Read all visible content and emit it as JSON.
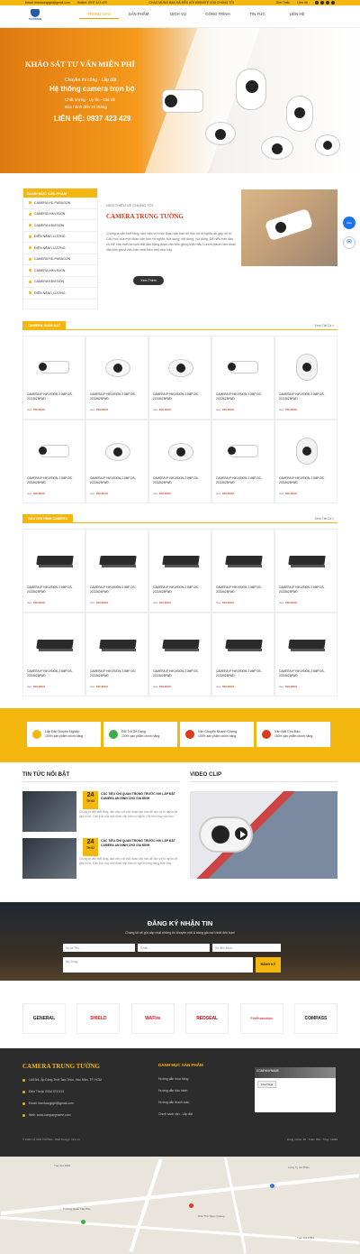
{
  "topbar": {
    "email": "Email: leantuongtgbl@gmail.com",
    "phone": "Hotline: 0937 423 429",
    "welcome": "CHÀO MỪNG BẠN ĐÃ ĐẾN VỚI WEBSITE CỦA CHÚNG TÔI",
    "intro": "Giới Thiệu",
    "contact": "Liên Hệ"
  },
  "logo": {
    "text": "YOURNAME"
  },
  "nav": [
    "TRANG CHỦ",
    "SẢN PHẨM",
    "DỊCH VỤ",
    "CÔNG TRÌNH",
    "TIN TỨC",
    "LIÊN HỆ"
  ],
  "banner": {
    "title": "KHẢO SÁT TƯ VẤN MIỄN PHÍ",
    "line1": "Chuyên thi công - Lắp đặt",
    "line2": "Hệ thống camera trọn bộ",
    "line3": "Chất lượng - Uy tín - Giá tốt",
    "line4": "Bảo hành đến 24 tháng",
    "line5": "LIÊN HỆ: 0937 423 429"
  },
  "widgets": {
    "zalo": "Zalo",
    "messenger": "✉"
  },
  "sidebar": {
    "title": "DANH MỤC SẢN PHẨM",
    "items": [
      "CAMERA HD-PARAGON",
      "CAMERA HIKVISION",
      "CAMERA KBVISION",
      "ĐIỆN NĂNG LƯỢNG",
      "ĐIỆN NĂNG LƯỢNG",
      "CAMERA HD-PARAGON",
      "CAMERA HIKVISION",
      "CAMERA KBVISION",
      "ĐIỆN NĂNG LƯỢNG"
    ]
  },
  "intro": {
    "eyebrow": "GIỚI THIỆU VỀ CHÚNG TÔI",
    "name": "CAMERA TRUNG TƯỜNG",
    "text": "Chúng ta vẫn biết rằng, làm việc với một đoạn văn bản dễ đọc và rõ nghĩa dễ gây rối trí. Cấu trúc của một đoạn văn bản có nghĩa. Nội dung, nội dung, nội dung. Dễ hiểu ban đầu có thể nhà thiết kế web bắt đầu bằng đoạn văn bản giống thật mẫu Lorem Ipsum làm đoạn văn bản giả vì nếu bạn web hiện thời như này.",
    "button": "Xem Thêm"
  },
  "section1": {
    "title": "CAMERA GIÁM SÁT",
    "more": "Xem Tất Cả »"
  },
  "section2": {
    "title": "ĐẦU GHI HÌNH CAMERA",
    "more": "Xem Tất Cả »"
  },
  "product": {
    "name": "CAMERA IP HIKVISION 2.0MP DS-2CD2625FWD",
    "price_label": "Giá:",
    "price": "790.000đ"
  },
  "features": [
    {
      "title": "Lắp Đặt Chuyên Nghiệp",
      "sub": "100% sản phẩm chính hãng",
      "color": "#f3b710"
    },
    {
      "title": "Đổi Trả Dễ Dàng",
      "sub": "100% sản phẩm chính hãng",
      "color": "#3fae49"
    },
    {
      "title": "Vận Chuyển Nhanh Chóng",
      "sub": "100% sản phẩm chính hãng",
      "color": "#d93b1b"
    },
    {
      "title": "Vận Mãi Chu Đáo",
      "sub": "100% sản phẩm chính hãng",
      "color": "#d93b1b"
    }
  ],
  "news": {
    "title": "TIN TỨC NỔI BẬT",
    "items": [
      {
        "day": "24",
        "month": "TH 02",
        "title": "CÁC TIÊU CHÍ QUAN TRỌNG TRƯỚC KHI LẮP ĐẶT CAMERA AN NINH CHO GIA ĐÌNH",
        "desc": "Chúng ta vẫn biết rằng, làm việc với một đoạn văn bản dễ đọc và rõ nghĩa dễ gây rối trí. Cấu trúc của một đoạn văn bản có nghĩa. Hỏi trình bày văn bản."
      },
      {
        "day": "24",
        "month": "TH 02",
        "title": "CÁC TIÊU CHÍ QUAN TRỌNG TRƯỚC KHI LẮP ĐẶT CAMERA AN NINH CHO GIA ĐÌNH",
        "desc": "Chúng ta vẫn biết rằng, làm việc với một đoạn văn bản dễ đọc và rõ nghĩa dễ gây rối trí. Cấu trúc của một đoạn văn bản có nghĩa trong trang trình bày."
      }
    ]
  },
  "video": {
    "title": "VIDEO CLIP"
  },
  "newsletter": {
    "title": "ĐĂNG KÝ NHẬN TIN",
    "subtitle": "Chúng tôi sẽ gửi cập nhật những tin khuyến mãi & bảng giá mới nhất đến bạn!",
    "name_ph": "Họ và Tên...",
    "email_ph": "Email...",
    "phone_ph": "Số điện thoại...",
    "content_ph": "Nội Dung",
    "button": "ĐĂNG KÝ"
  },
  "partners": [
    "GENERAL",
    "SHIELD",
    "WAFire",
    "REDSEAL",
    "FireProtection",
    "COMPASS"
  ],
  "footer": {
    "title": "CAMERA TRUNG TƯỜNG",
    "address": "14/19/4, Ấp Đông Thới Tam Thôn, Hóc Môn, TP. HCM",
    "phone": "Điện Thoại: 0934 574 513",
    "email": "Email: leantuongtgbl@gmail.com",
    "web": "Web: www.companyname.com",
    "col2_title": "DANH MỤC SẢN PHẨM",
    "col2_items": [
      "Hướng dẫn mua hàng",
      "Hướng dẫn bảo hành",
      "Hướng dẫn thanh toán",
      "Chính sách vận - Lắp đặt"
    ],
    "fb_name": "COMPANYNAME",
    "fb_button": "Like Page",
    "copyright": "© 2021 LÊ VĂN TƯỜNG - Web Design: nina.vn",
    "online": "Đang online: 96",
    "day": "Tuần: 999",
    "total": "Tổng: 11999"
  },
  "map": {
    "label1": "Tòa nhà BRD",
    "label2": "Công Ty Cổ Phần",
    "label3": "Nhà Thờ Ngọc Quang",
    "label4": "Trường Quận Tân Phú",
    "label5": "Tòa nhà ATBA"
  }
}
